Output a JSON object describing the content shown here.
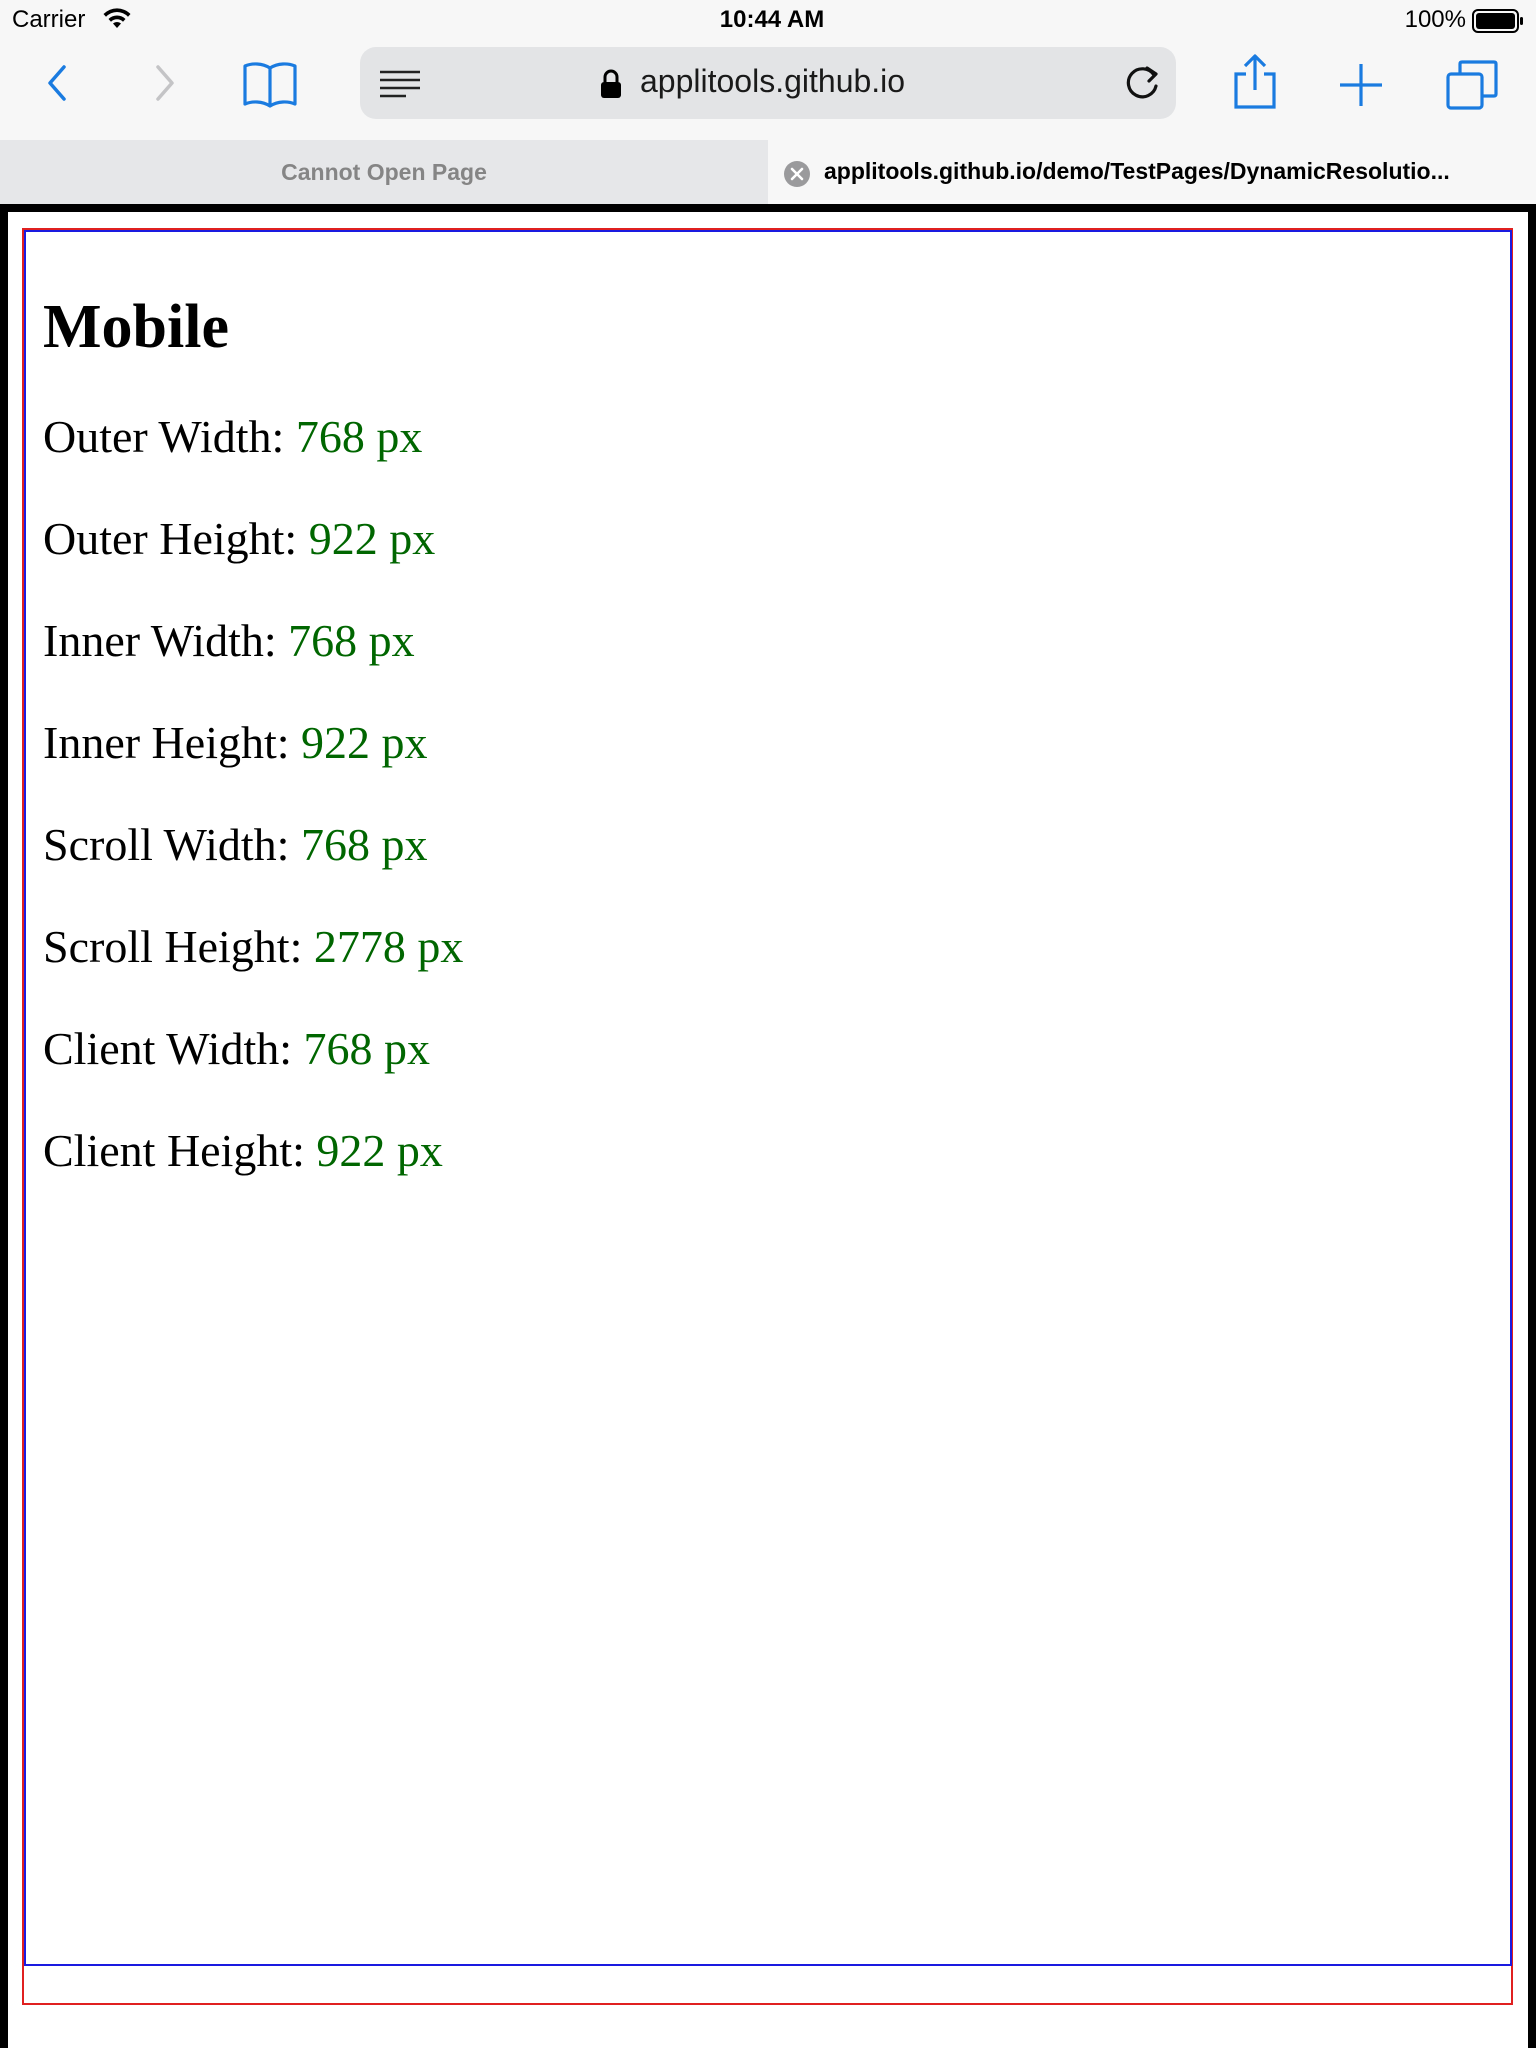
{
  "status_bar": {
    "carrier": "Carrier",
    "time": "10:44 AM",
    "battery": "100%"
  },
  "toolbar": {
    "url": "applitools.github.io",
    "icons": [
      "back-icon",
      "forward-icon",
      "bookmarks-icon",
      "reader-icon",
      "lock-icon",
      "reload-icon",
      "share-icon",
      "new-tab-icon",
      "tabs-icon"
    ]
  },
  "tabs": [
    {
      "title": "Cannot Open Page",
      "active": false
    },
    {
      "title": "applitools.github.io/demo/TestPages/DynamicResolutio...",
      "active": true
    }
  ],
  "page": {
    "heading": "Mobile",
    "metrics": [
      {
        "label": "Outer Width:",
        "value": "768 px"
      },
      {
        "label": "Outer Height:",
        "value": "922 px"
      },
      {
        "label": "Inner Width:",
        "value": "768 px"
      },
      {
        "label": "Inner Height:",
        "value": "922 px"
      },
      {
        "label": "Scroll Width:",
        "value": "768 px"
      },
      {
        "label": "Scroll Height:",
        "value": "2778 px"
      },
      {
        "label": "Client Width:",
        "value": "768 px"
      },
      {
        "label": "Client Height:",
        "value": "922 px"
      }
    ]
  },
  "colors": {
    "accent": "#1a7be0",
    "value_text": "#006600",
    "outer_box": "#e02020",
    "inner_box": "#1a1ae0"
  }
}
